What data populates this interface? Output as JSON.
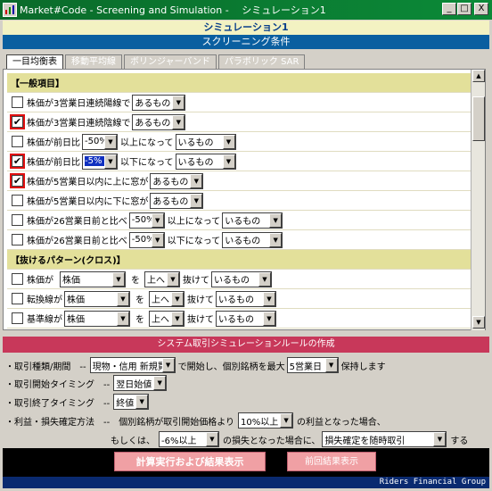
{
  "window": {
    "title": "Market#Code - Screening and Simulation -　 シミュレーション1",
    "minimize": "_",
    "maximize": "□",
    "close": "X"
  },
  "header": {
    "simulation_name": "シミュレーション1",
    "section_title": "スクリーニング条件"
  },
  "tabs": [
    "一目均衡表",
    "移動平均線",
    "ボリンジャーバンド",
    "パラボリック SAR"
  ],
  "sections": [
    {
      "title": "【一般項目】"
    },
    {
      "title": "【抜けるパターン(クロス)】"
    }
  ],
  "rows": [
    {
      "checked": false,
      "label": "株価が3営業日連続陽線で",
      "dd1": "あるもの"
    },
    {
      "checked": true,
      "label": "株価が3営業日連続陰線で",
      "dd1": "あるもの"
    },
    {
      "checked": false,
      "label": "株価が前日比",
      "dd1": "-50%",
      "mid": "以上になって",
      "dd2": "いるもの"
    },
    {
      "checked": true,
      "label": "株価が前日比",
      "dd1": "-5%",
      "mid": "以下になって",
      "dd2": "いるもの"
    },
    {
      "checked": true,
      "label": "株価が5営業日以内に上に窓が",
      "dd1": "あるもの"
    },
    {
      "checked": false,
      "label": "株価が5営業日以内に下に窓が",
      "dd1": "あるもの"
    },
    {
      "checked": false,
      "label": "株価が26営業日前と比べ",
      "dd1": "-50%",
      "mid": "以上になって",
      "dd2": "いるもの"
    },
    {
      "checked": false,
      "label": "株価が26営業日前と比べ",
      "dd1": "-50%",
      "mid": "以下になって",
      "dd2": "いるもの"
    }
  ],
  "cross_rows": [
    {
      "checked": false,
      "label": "株価が",
      "dd1": "株価",
      "mid1": "を",
      "dd2": "上へ",
      "mid2": "抜けて",
      "dd3": "いるもの"
    },
    {
      "checked": false,
      "label": "転換線が",
      "dd1": "株価",
      "mid1": "を",
      "dd2": "上へ",
      "mid2": "抜けて",
      "dd3": "いるもの"
    },
    {
      "checked": false,
      "label": "基準線が",
      "dd1": "株価",
      "mid1": "を",
      "dd2": "上へ",
      "mid2": "抜けて",
      "dd3": "いるもの"
    }
  ],
  "simulation": {
    "title": "システム取引シミュレーションルールの作成",
    "line1": {
      "label": "・取引種類/期間　--",
      "dd1": "現物・信用 新規買",
      "mid": "で開始し、個別銘柄を最大",
      "dd2": "5営業日",
      "end": "保持します"
    },
    "line2": {
      "label": "・取引開始タイミング　--",
      "dd1": "翌日始値"
    },
    "line3": {
      "label": "・取引終了タイミング　--",
      "dd1": "終値"
    },
    "line4": {
      "label": "・利益・損失確定方法　--　個別銘柄が取引開始価格より",
      "dd1": "10%以上",
      "end": "の利益となった場合、"
    },
    "line5": {
      "label": "もしくは、",
      "dd1": "-6%以上",
      "mid": "の損失となった場合に、",
      "dd2": "損失確定を随時取引",
      "end": "する"
    }
  },
  "buttons": {
    "run": "計算実行および結果表示",
    "previous": "前回結果表示"
  },
  "brand": "Riders Financial Group"
}
